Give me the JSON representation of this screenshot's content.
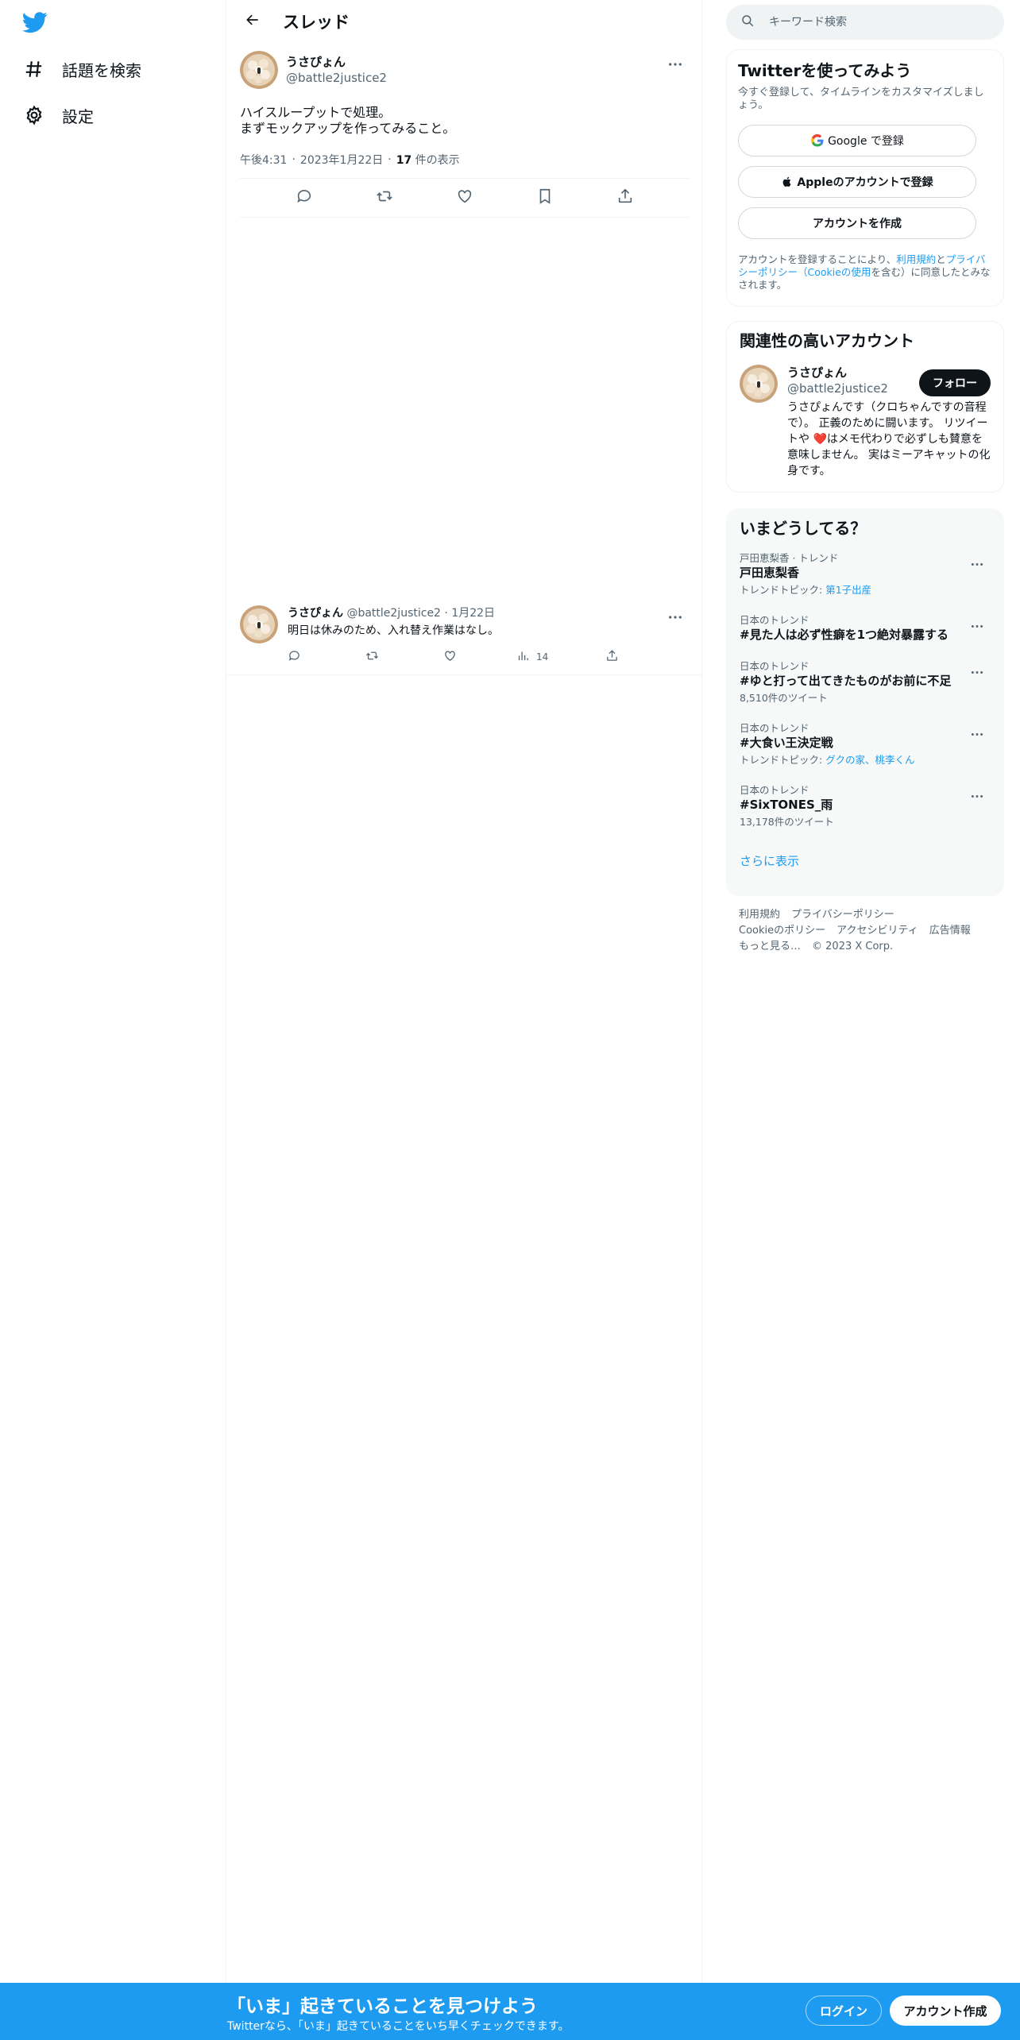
{
  "nav": {
    "logo_icon": "twitter-bird-icon",
    "items": [
      {
        "label": "話題を検索",
        "icon": "hashtag-icon"
      },
      {
        "label": "設定",
        "icon": "gear-icon"
      }
    ]
  },
  "header": {
    "title": "スレッド",
    "back_icon": "arrow-left-icon"
  },
  "main_tweet": {
    "name": "うさぴょん",
    "handle": "@battle2justice2",
    "text_line1": "ハイスループットで処理。",
    "text_line2": "まずモックアップを作ってみること。",
    "time": "午後4:31",
    "date": "2023年1月22日",
    "views_count": "17",
    "views_label": "件の表示"
  },
  "reply_tweet": {
    "name": "うさぴょん",
    "handle": "@battle2justice2",
    "date": "1月22日",
    "text": "明日は休みのため、入れ替え作業はなし。",
    "views": "14"
  },
  "search": {
    "placeholder": "キーワード検索"
  },
  "signup": {
    "title": "Twitterを使ってみよう",
    "subtitle": "今すぐ登録して、タイムラインをカスタマイズしましょう。",
    "google_label": "Google で登録",
    "apple_label": "Appleのアカウントで登録",
    "create_label": "アカウントを作成",
    "legal_pre": "アカウントを登録することにより、",
    "legal_terms": "利用規約",
    "legal_and": "と",
    "legal_privacy": "プライバシーポリシー（Cookieの使用",
    "legal_post": "を含む）に同意したとみなされます。"
  },
  "related": {
    "title": "関連性の高いアカウント",
    "name": "うさぴょん",
    "handle": "@battle2justice2",
    "follow_label": "フォロー",
    "bio_part1": "うさぴょんです（クロちゃんですの音程で）。 正義のために闘います。 リツイートや ",
    "bio_part2": "はメモ代わりで必ずしも賛意を意味しません。 実はミーアキャットの化身です。"
  },
  "trends": {
    "title": "いまどうしてる？",
    "items": [
      {
        "context": "戸田恵梨香 · トレンド",
        "name": "戸田恵梨香",
        "sub_prefix": "トレンドトピック: ",
        "sub_link": "第1子出産"
      },
      {
        "context": "日本のトレンド",
        "name": "#見た人は必ず性癖を1つ絶対暴露する",
        "sub_prefix": "",
        "sub_link": ""
      },
      {
        "context": "日本のトレンド",
        "name": "#ゆと打って出てきたものがお前に不足",
        "sub_prefix": "8,510件のツイート",
        "sub_link": ""
      },
      {
        "context": "日本のトレンド",
        "name": "#大食い王決定戦",
        "sub_prefix": "トレンドトピック: ",
        "sub_link": "グクの家、桃李くん"
      },
      {
        "context": "日本のトレンド",
        "name": "#SixTONES_雨",
        "sub_prefix": "13,178件のツイート",
        "sub_link": ""
      }
    ],
    "show_more": "さらに表示"
  },
  "footer": {
    "links": [
      "利用規約",
      "プライバシーポリシー",
      "Cookieのポリシー",
      "アクセシビリティ",
      "広告情報",
      "もっと見る…"
    ],
    "copyright": "© 2023 X Corp."
  },
  "bottom_bar": {
    "title": "「いま」起きていることを見つけよう",
    "subtitle": "Twitterなら、「いま」起きていることをいち早くチェックできます。",
    "login": "ログイン",
    "create": "アカウント作成"
  },
  "colors": {
    "accent": "#1d9bf0",
    "text": "#0f1419",
    "muted": "#536471",
    "border": "#eff3f4"
  }
}
